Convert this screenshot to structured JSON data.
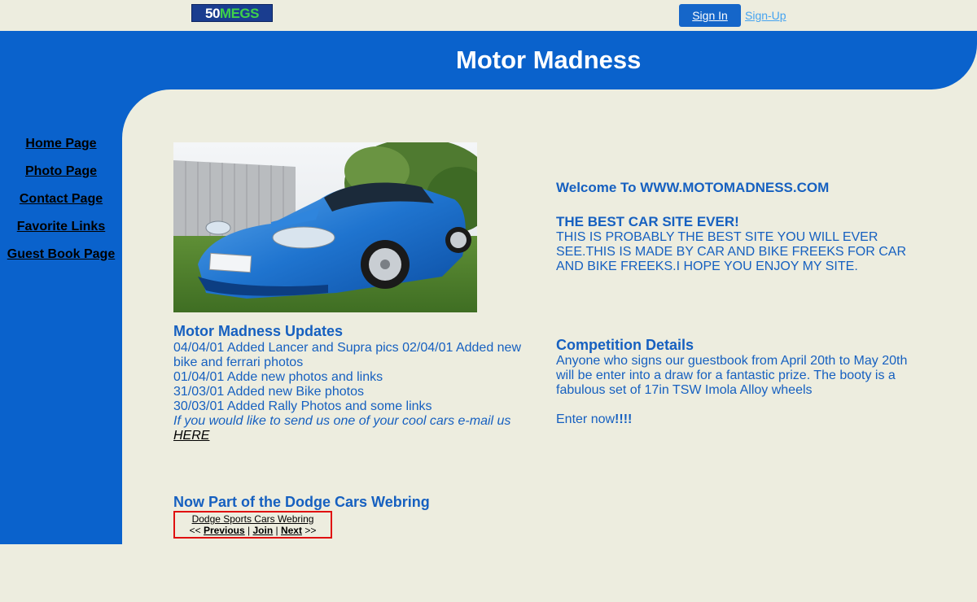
{
  "topbar": {
    "logo_num": "50",
    "logo_text": "MEGS",
    "signin_label": "Sign In",
    "signup_label": "Sign-Up"
  },
  "header": {
    "title": "Motor Madness"
  },
  "nav": {
    "items": [
      {
        "label": "Home Page"
      },
      {
        "label": "Photo Page"
      },
      {
        "label": "Contact Page"
      },
      {
        "label": "Favorite Links"
      },
      {
        "label": "Guest Book Page"
      }
    ]
  },
  "updates": {
    "title": "Motor Madness Updates",
    "lines": [
      "04/04/01 Added Lancer and Supra pics 02/04/01 Added new bike and ferrari photos",
      "01/04/01 Adde new photos and links",
      "31/03/01 Added new Bike photos",
      "30/03/01 Added Rally Photos and some links"
    ],
    "cta": "If you would like to send us one of your cool cars e-mail us",
    "here_link": "HERE"
  },
  "welcome": {
    "title": "Welcome To WWW.MOTOMADNESS.COM",
    "subtitle": "THE BEST CAR SITE EVER!",
    "body": "THIS IS PROBABLY THE BEST SITE YOU WILL EVER SEE.THIS IS MADE BY CAR AND BIKE FREEKS FOR CAR AND BIKE FREEKS.I HOPE YOU ENJOY MY SITE."
  },
  "competition": {
    "title": "Competition Details",
    "body": "Anyone who signs our guestbook from April 20th to May 20th will be enter into a draw for a fantastic prize. The booty is a fabulous set of 17in TSW Imola Alloy wheels",
    "enter_prefix": "Enter now",
    "enter_suffix": "!!!!"
  },
  "webring": {
    "title": "Now Part of the Dodge Cars Webring",
    "ring_name": "Dodge Sports Cars Webring",
    "prev_prefix": "<< ",
    "previous": "Previous",
    "sep1": " | ",
    "join": "Join",
    "sep2": " | ",
    "next": "Next",
    "next_suffix": " >>"
  },
  "colors": {
    "brand_blue": "#0a62cc",
    "background": "#ededdf",
    "text_blue": "#1660c0",
    "webring_border": "#e01010"
  }
}
